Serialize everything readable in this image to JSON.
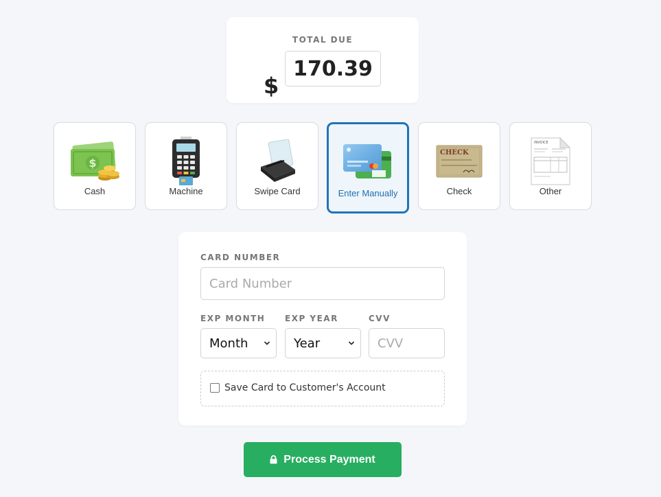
{
  "total": {
    "label": "TOTAL DUE",
    "currency_symbol": "$",
    "amount": "170.39"
  },
  "methods": [
    {
      "label": "Cash",
      "icon": "cash-icon",
      "selected": false
    },
    {
      "label": "Machine",
      "icon": "card-machine-icon",
      "selected": false
    },
    {
      "label": "Swipe Card",
      "icon": "swipe-card-icon",
      "selected": false
    },
    {
      "label": "Enter Manually",
      "icon": "credit-cards-icon",
      "selected": true
    },
    {
      "label": "Check",
      "icon": "check-icon",
      "selected": false
    },
    {
      "label": "Other",
      "icon": "invoice-icon",
      "selected": false
    }
  ],
  "form": {
    "card_number_label": "CARD NUMBER",
    "card_number_placeholder": "Card Number",
    "card_number_value": "",
    "exp_month_label": "EXP MONTH",
    "exp_month_value": "Month",
    "exp_year_label": "EXP YEAR",
    "exp_year_value": "Year",
    "cvv_label": "CVV",
    "cvv_placeholder": "CVV",
    "cvv_value": "",
    "save_card_label": "Save Card to Customer's Account",
    "save_card_checked": false
  },
  "process_button": {
    "label": "Process Payment",
    "icon": "lock-icon"
  },
  "colors": {
    "accent_blue": "#1f74b8",
    "success_green": "#27ae60",
    "background": "#f4f6f9"
  }
}
